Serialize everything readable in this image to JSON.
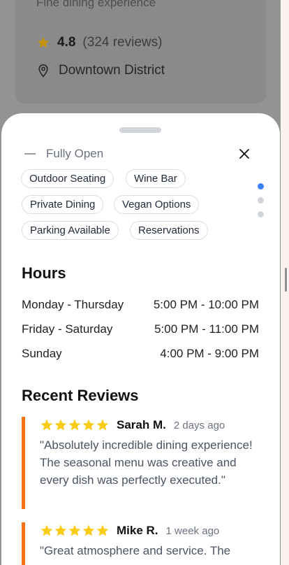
{
  "background_card": {
    "subtitle": "Fine dining experience",
    "rating": "4.8",
    "review_count": "(324 reviews)",
    "location": "Downtown District",
    "star_color": "#d4a000"
  },
  "sheet": {
    "state_label": "Fully Open",
    "tags_row0": [
      "Outdoor Seating",
      "Wine Bar"
    ],
    "tags_row1": [
      "Private Dining",
      "Vegan Options"
    ],
    "tags_row2": [
      "Parking Available",
      "Reservations"
    ],
    "page_dots": 3,
    "active_dot": 0,
    "accent": "#3b82f6"
  },
  "hours": {
    "title": "Hours",
    "rows": [
      {
        "day": "Monday - Thursday",
        "time": "5:00 PM - 10:00 PM"
      },
      {
        "day": "Friday - Saturday",
        "time": "5:00 PM - 11:00 PM"
      },
      {
        "day": "Sunday",
        "time": "4:00 PM - 9:00 PM"
      }
    ]
  },
  "reviews": {
    "title": "Recent Reviews",
    "accent": "#f97316",
    "star_color": "#facc15",
    "items": [
      {
        "name": "Sarah M.",
        "ago": "2 days ago",
        "stars": 5,
        "text": "\"Absolutely incredible dining experience! The seasonal menu was creative and every dish was perfectly executed.\""
      },
      {
        "name": "Mike R.",
        "ago": "1 week ago",
        "stars": 5,
        "text": "\"Great atmosphere and service. The"
      }
    ]
  }
}
